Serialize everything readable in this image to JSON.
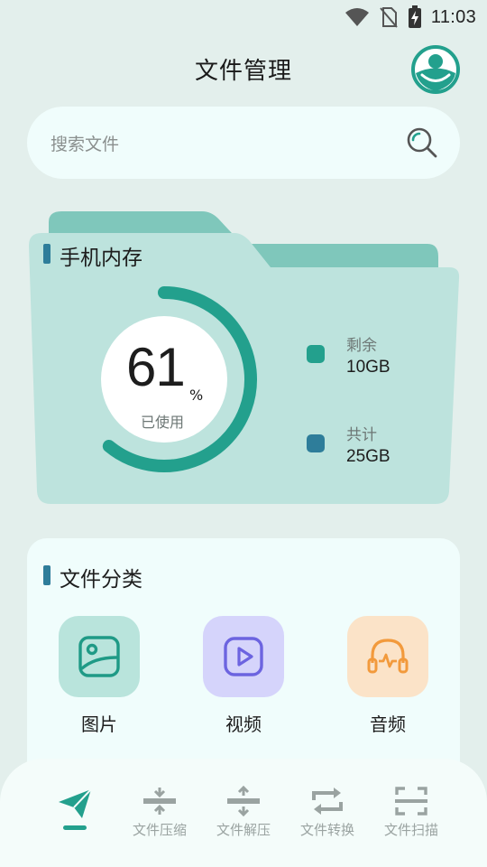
{
  "status_bar": {
    "time": "11:03"
  },
  "header": {
    "title": "文件管理",
    "avatar_icon": "user-avatar"
  },
  "search": {
    "placeholder": "搜索文件",
    "icon": "search-icon"
  },
  "storage": {
    "title": "手机内存",
    "used_percent": 61,
    "percent_sign": "%",
    "used_label": "已使用",
    "remaining_label": "剩余",
    "remaining_value": "10GB",
    "total_label": "共计",
    "total_value": "25GB",
    "colors": {
      "ring": "#23a08d",
      "remaining": "#23a08d",
      "total": "#2e7d9a",
      "folder": "#bde3dd",
      "folder_tab": "#7fc7bb"
    }
  },
  "categories": {
    "title": "文件分类",
    "items": [
      {
        "label": "图片",
        "icon": "image-icon",
        "color": "#b9e4dc",
        "stroke": "#1f9a86"
      },
      {
        "label": "视频",
        "icon": "video-icon",
        "color": "#d5d4fb",
        "stroke": "#6c64e0"
      },
      {
        "label": "音频",
        "icon": "headphones-icon",
        "color": "#fbe3c8",
        "stroke": "#f29a3c"
      }
    ]
  },
  "bottom_nav": {
    "items": [
      {
        "label": "",
        "icon": "send-icon",
        "active": true
      },
      {
        "label": "文件压缩",
        "icon": "compress-icon"
      },
      {
        "label": "文件解压",
        "icon": "decompress-icon"
      },
      {
        "label": "文件转换",
        "icon": "convert-icon"
      },
      {
        "label": "文件扫描",
        "icon": "scan-icon"
      }
    ]
  }
}
